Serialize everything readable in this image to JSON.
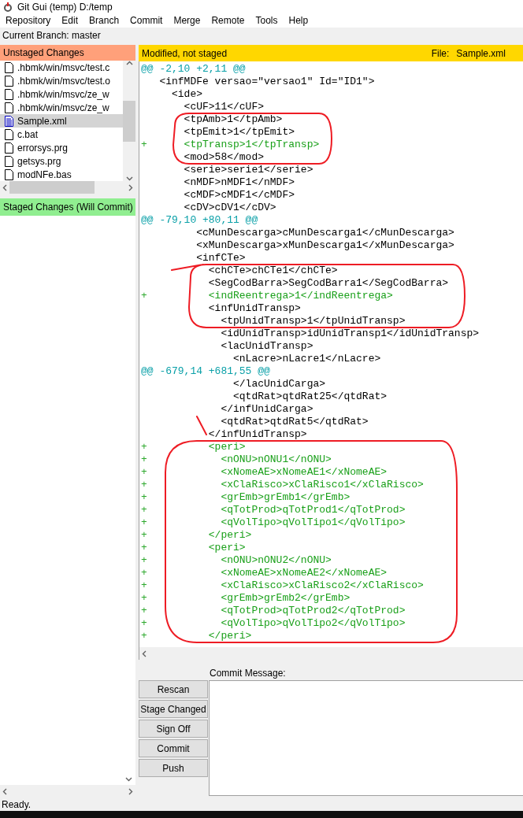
{
  "window": {
    "title": "Git Gui (temp) D:/temp"
  },
  "menu": [
    "Repository",
    "Edit",
    "Branch",
    "Commit",
    "Merge",
    "Remote",
    "Tools",
    "Help"
  ],
  "current_branch": "Current Branch: master",
  "unstaged": {
    "title": "Unstaged Changes",
    "files": [
      {
        "name": ".hbmk/win/msvc/test.c",
        "kind": "untracked",
        "selected": false
      },
      {
        "name": ".hbmk/win/msvc/test.o",
        "kind": "untracked",
        "selected": false
      },
      {
        "name": ".hbmk/win/msvc/ze_w",
        "kind": "untracked",
        "selected": false
      },
      {
        "name": ".hbmk/win/msvc/ze_w",
        "kind": "untracked",
        "selected": false
      },
      {
        "name": "Sample.xml",
        "kind": "modified",
        "selected": true
      },
      {
        "name": "c.bat",
        "kind": "untracked",
        "selected": false
      },
      {
        "name": "errorsys.prg",
        "kind": "untracked",
        "selected": false
      },
      {
        "name": "getsys.prg",
        "kind": "untracked",
        "selected": false
      },
      {
        "name": "modNFe.bas",
        "kind": "untracked",
        "selected": false
      }
    ]
  },
  "staged": {
    "title": "Staged Changes (Will Commit)"
  },
  "diff": {
    "status": "Modified, not staged",
    "file_label": "File:",
    "file": "Sample.xml",
    "lines": [
      {
        "kind": "hunk",
        "text": "@@ -2,10 +2,11 @@"
      },
      {
        "kind": "context",
        "text": "  <infMDFe versao=\"versao1\" Id=\"ID1\">"
      },
      {
        "kind": "context",
        "text": "    <ide>"
      },
      {
        "kind": "context",
        "text": "      <cUF>11</cUF>"
      },
      {
        "kind": "context",
        "text": "      <tpAmb>1</tpAmb>"
      },
      {
        "kind": "context",
        "text": "      <tpEmit>1</tpEmit>"
      },
      {
        "kind": "add",
        "marker": "+",
        "text": "      <tpTransp>1</tpTransp>"
      },
      {
        "kind": "context",
        "text": "      <mod>58</mod>"
      },
      {
        "kind": "context",
        "text": "      <serie>serie1</serie>"
      },
      {
        "kind": "context",
        "text": "      <nMDF>nMDF1</nMDF>"
      },
      {
        "kind": "context",
        "text": "      <cMDF>cMDF1</cMDF>"
      },
      {
        "kind": "context",
        "text": "      <cDV>cDV1</cDV>"
      },
      {
        "kind": "hunk",
        "text": "@@ -79,10 +80,11 @@"
      },
      {
        "kind": "context",
        "text": "        <cMunDescarga>cMunDescarga1</cMunDescarga>"
      },
      {
        "kind": "context",
        "text": "        <xMunDescarga>xMunDescarga1</xMunDescarga>"
      },
      {
        "kind": "context",
        "text": "        <infCTe>"
      },
      {
        "kind": "context",
        "text": "          <chCTe>chCTe1</chCTe>"
      },
      {
        "kind": "context",
        "text": "          <SegCodBarra>SegCodBarra1</SegCodBarra>"
      },
      {
        "kind": "add",
        "marker": "+",
        "text": "          <indReentrega>1</indReentrega>"
      },
      {
        "kind": "context",
        "text": "          <infUnidTransp>"
      },
      {
        "kind": "context",
        "text": "            <tpUnidTransp>1</tpUnidTransp>"
      },
      {
        "kind": "context",
        "text": "            <idUnidTransp>idUnidTransp1</idUnidTransp>"
      },
      {
        "kind": "context",
        "text": "            <lacUnidTransp>"
      },
      {
        "kind": "context",
        "text": "              <nLacre>nLacre1</nLacre>"
      },
      {
        "kind": "hunk",
        "text": "@@ -679,14 +681,55 @@"
      },
      {
        "kind": "context",
        "text": "              </lacUnidCarga>"
      },
      {
        "kind": "context",
        "text": "              <qtdRat>qtdRat25</qtdRat>"
      },
      {
        "kind": "context",
        "text": "            </infUnidCarga>"
      },
      {
        "kind": "context",
        "text": "            <qtdRat>qtdRat5</qtdRat>"
      },
      {
        "kind": "context",
        "text": "          </infUnidTransp>"
      },
      {
        "kind": "add",
        "marker": "+",
        "text": "          <peri>"
      },
      {
        "kind": "add",
        "marker": "+",
        "text": "            <nONU>nONU1</nONU>"
      },
      {
        "kind": "add",
        "marker": "+",
        "text": "            <xNomeAE>xNomeAE1</xNomeAE>"
      },
      {
        "kind": "add",
        "marker": "+",
        "text": "            <xClaRisco>xClaRisco1</xClaRisco>"
      },
      {
        "kind": "add",
        "marker": "+",
        "text": "            <grEmb>grEmb1</grEmb>"
      },
      {
        "kind": "add",
        "marker": "+",
        "text": "            <qTotProd>qTotProd1</qTotProd>"
      },
      {
        "kind": "add",
        "marker": "+",
        "text": "            <qVolTipo>qVolTipo1</qVolTipo>"
      },
      {
        "kind": "add",
        "marker": "+",
        "text": "          </peri>"
      },
      {
        "kind": "add",
        "marker": "+",
        "text": "          <peri>"
      },
      {
        "kind": "add",
        "marker": "+",
        "text": "            <nONU>nONU2</nONU>"
      },
      {
        "kind": "add",
        "marker": "+",
        "text": "            <xNomeAE>xNomeAE2</xNomeAE>"
      },
      {
        "kind": "add",
        "marker": "+",
        "text": "            <xClaRisco>xClaRisco2</xClaRisco>"
      },
      {
        "kind": "add",
        "marker": "+",
        "text": "            <grEmb>grEmb2</grEmb>"
      },
      {
        "kind": "add",
        "marker": "+",
        "text": "            <qTotProd>qTotProd2</qTotProd>"
      },
      {
        "kind": "add",
        "marker": "+",
        "text": "            <qVolTipo>qVolTipo2</qVolTipo>"
      },
      {
        "kind": "add",
        "marker": "+",
        "text": "          </peri>"
      }
    ]
  },
  "commit": {
    "label": "Commit Message:",
    "buttons": [
      "Rescan",
      "Stage Changed",
      "Sign Off",
      "Commit",
      "Push"
    ]
  },
  "ink_marks": [
    {
      "kind": "loop"
    },
    {
      "kind": "loop"
    },
    {
      "kind": "loop"
    }
  ],
  "status_bar": "Ready."
}
